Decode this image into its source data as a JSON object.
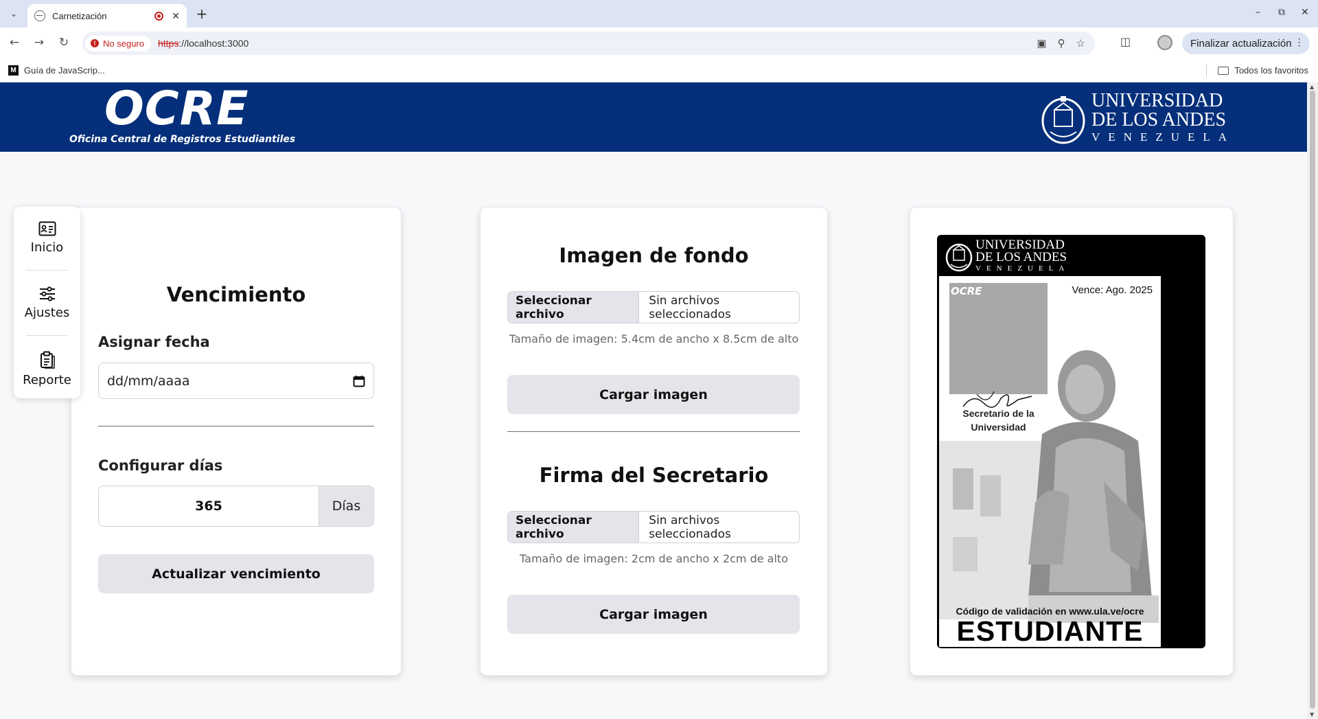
{
  "browser": {
    "tab_title": "Carnetización",
    "security_label": "No seguro",
    "url_scheme": "https",
    "url_rest": "://localhost:3000",
    "update_button": "Finalizar actualización",
    "bookmark_1": "Guía de JavaScrip...",
    "bookmark_all": "Todos los favoritos"
  },
  "header": {
    "logo": "OCRE",
    "subtitle": "Oficina Central de Registros Estudiantiles",
    "university_line1": "UNIVERSIDAD",
    "university_line2": "DE LOS ANDES",
    "university_line3": "VENEZUELA"
  },
  "sidebar": {
    "items": [
      {
        "label": "Inicio",
        "icon": "id-card-icon"
      },
      {
        "label": "Ajustes",
        "icon": "sliders-icon"
      },
      {
        "label": "Reporte",
        "icon": "clipboard-icon"
      }
    ]
  },
  "vencimiento": {
    "title": "Vencimiento",
    "date_label": "Asignar fecha",
    "date_placeholder": "dd/mm/aaaa",
    "days_label": "Configurar días",
    "days_value": "365",
    "days_unit": "Días",
    "update_button": "Actualizar vencimiento"
  },
  "images": {
    "background_title": "Imagen de fondo",
    "background_pick": "Seleccionar archivo",
    "background_none": "Sin archivos seleccionados",
    "background_hint": "Tamaño de imagen: 5.4cm de ancho x 8.5cm de alto",
    "background_button": "Cargar imagen",
    "signature_title": "Firma del Secretario",
    "signature_pick": "Seleccionar archivo",
    "signature_none": "Sin archivos seleccionados",
    "signature_hint": "Tamaño de imagen: 2cm de ancho x 2cm de alto",
    "signature_button": "Cargar imagen"
  },
  "preview": {
    "university_line1": "UNIVERSIDAD",
    "university_line2": "DE LOS ANDES",
    "university_line3": "VENEZUELA",
    "photo_label": "OCRE",
    "expiry": "Vence: Ago. 2025",
    "secretary": "Secretario de la Universidad",
    "validation": "Código de validación en www.ula.ve/ocre",
    "role": "ESTUDIANTE"
  },
  "colors": {
    "header_bg": "#052f7a",
    "button_bg": "#e3e5ea",
    "insecure": "#c5221f"
  }
}
